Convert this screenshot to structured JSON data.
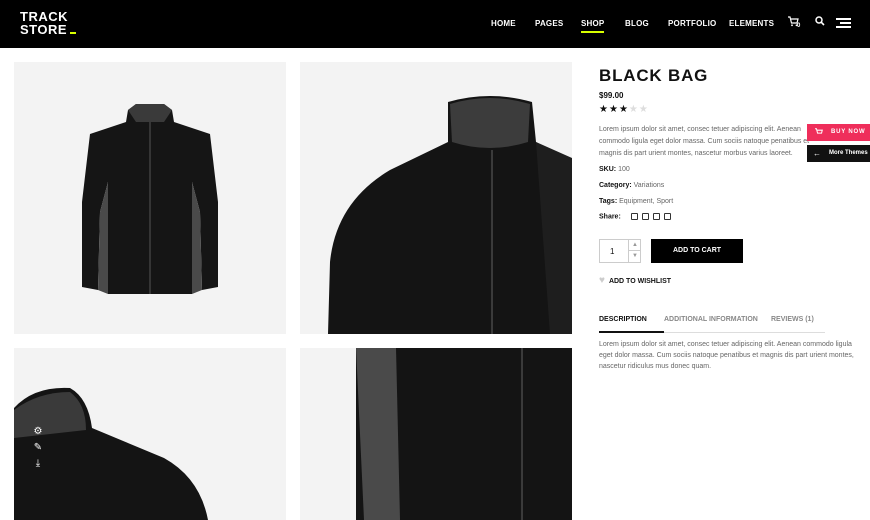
{
  "brand": {
    "line1": "TRACK",
    "line2": "STORE"
  },
  "nav": [
    {
      "label": "HOME"
    },
    {
      "label": "PAGES"
    },
    {
      "label": "SHOP",
      "active": true
    },
    {
      "label": "BLOG"
    },
    {
      "label": "PORTFOLIO"
    },
    {
      "label": "ELEMENTS"
    }
  ],
  "header_icons": {
    "cart": "cart-icon",
    "cart_count": "0",
    "search": "search-icon",
    "menu": "hamburger-menu-icon"
  },
  "product": {
    "title": "BLACK BAG",
    "price": "$99.00",
    "rating": {
      "value": 3,
      "max": 5
    },
    "short_description": "Lorem ipsum dolor sit amet, consec tetuer adipiscing elit. Aenean commodo ligula eget dolor massa. Cum sociis natoque penatibus et magnis dis part urient montes, nascetur morbus varius laoreet.",
    "sku_label": "SKU:",
    "sku": "100",
    "category_label": "Category:",
    "category": "Variations",
    "tags_label": "Tags:",
    "tags": "Equipment, Sport",
    "share_label": "Share:",
    "share_icons": [
      "facebook-icon",
      "twitter-icon",
      "linkedin-icon",
      "pinterest-icon"
    ],
    "quantity": "1",
    "add_to_cart": "ADD TO CART",
    "wishlist": "ADD TO WISHLIST"
  },
  "tabs": [
    {
      "label": "DESCRIPTION",
      "active": true
    },
    {
      "label": "ADDITIONAL INFORMATION"
    },
    {
      "label": "REVIEWS (1)"
    }
  ],
  "tab_content": "Lorem ipsum dolor sit amet, consec tetuer adipiscing elit. Aenean commodo ligula eget dolor massa. Cum sociis natoque penatibus et magnis dis part urient montes, nascetur ridiculus mus donec quam.",
  "side_tools": [
    "settings-icon",
    "edit-icon",
    "download-icon"
  ],
  "floating": {
    "buy_now": "BUY NOW",
    "more_themes": "More Themes"
  },
  "colors": {
    "accent": "#d8ff00",
    "buy_now": "#ef2e5b",
    "header": "#000000"
  }
}
